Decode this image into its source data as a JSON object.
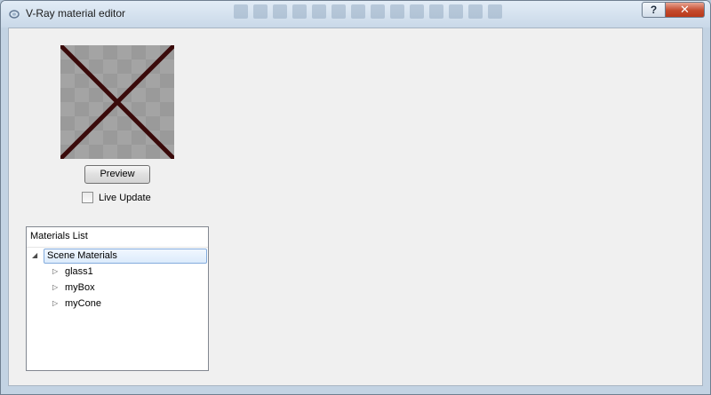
{
  "window": {
    "title": "V-Ray material editor",
    "help_label": "?",
    "close_label": "✕"
  },
  "preview": {
    "button_label": "Preview",
    "live_update_label": "Live Update",
    "live_update_checked": false
  },
  "materials": {
    "header": "Materials List",
    "root_label": "Scene Materials",
    "items": [
      "glass1",
      "myBox",
      "myCone"
    ]
  }
}
